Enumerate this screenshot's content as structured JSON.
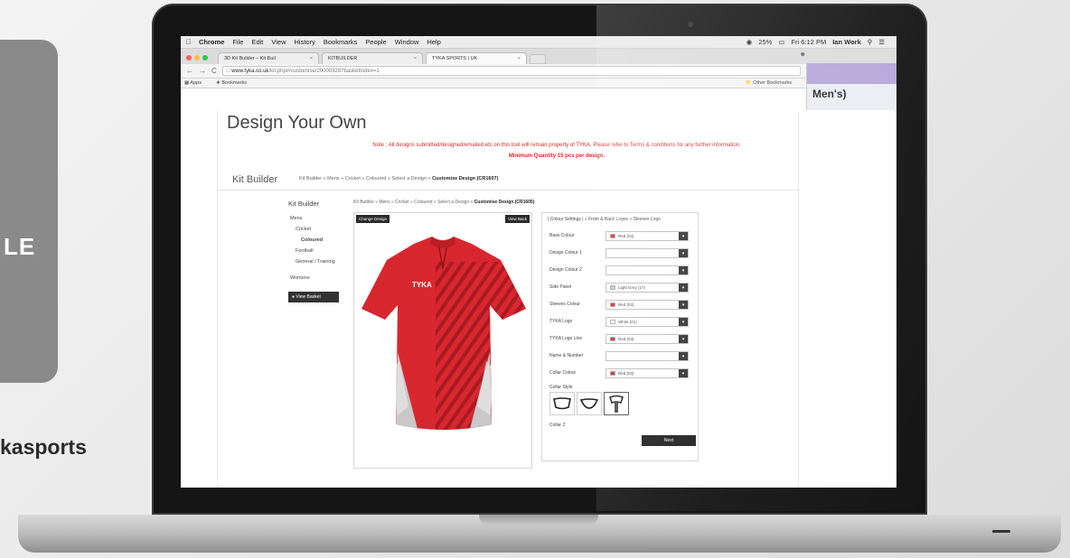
{
  "slide": {
    "card_text": "LE",
    "handle": "kasports"
  },
  "macbar": {
    "items": [
      "Chrome",
      "File",
      "Edit",
      "View",
      "History",
      "Bookmarks",
      "People",
      "Window",
      "Help"
    ],
    "battery": "25%",
    "clock": "Fri 6:12 PM",
    "user": "Ian Work"
  },
  "browser": {
    "tabs": [
      {
        "label": "3D Kit Builder – Kit Buil"
      },
      {
        "label": "KITBUILDER"
      },
      {
        "label": "TYKA SPORTS | UK"
      }
    ],
    "url_host": "www.tyka.co.uk",
    "url_path": "/kit.php#/customise/20000326?basketIndex=1",
    "bookmarks": {
      "apps": "Apps",
      "bookmarks": "Bookmarks",
      "other": "Other Bookmarks"
    }
  },
  "side_panel": {
    "text": "Men's)"
  },
  "page": {
    "title": "Design Your Own",
    "note": "Note : All designs submitted/designed/emailed etc on this tool will remain property of TYKA. Please refer to Terms & conditions for any further information.",
    "min_qty": "Minimum Quantity 15 pcs per design.",
    "kit_builder_label": "Kit Builder",
    "crumb_plain": "Kit Builder » Mens » Cricket » Coloured » Select a Design »",
    "crumb_bold": "Customise Design (CR1607)"
  },
  "left_nav": {
    "title": "Kit Builder",
    "items": [
      "Mens",
      "Cricket",
      "Coloured",
      "Football",
      "General / Training",
      "Womens"
    ],
    "view_basket": "View Basket"
  },
  "builder": {
    "crumb_plain": "Kit Builder » Mens » Cricket » Coloured » Select a Design »",
    "crumb_bold": "Customise Design (CR1605)",
    "change_design": "Change Design",
    "view_back": "View Back",
    "shirt_logo": "TYKA",
    "shirt_color": "#d8272f",
    "panel_color": "#c9c9c9"
  },
  "settings": {
    "tabs": "| Colour Settings | » Front & Back Logos » Sleeves Logo",
    "rows": [
      {
        "label": "Base Colour",
        "value": "Red (03)",
        "swatch": "#d8272f"
      },
      {
        "label": "Design Colour 1",
        "value": "",
        "swatch": ""
      },
      {
        "label": "Design Colour 2",
        "value": "",
        "swatch": ""
      },
      {
        "label": "Side Panel",
        "value": "Light Grey (17)",
        "swatch": "#c9c9c9"
      },
      {
        "label": "Sleeves Colour",
        "value": "Red (03)",
        "swatch": "#d8272f"
      },
      {
        "label": "TYKA Logo",
        "value": "White (01)",
        "swatch": "#ffffff"
      },
      {
        "label": "TYKA Logo Line",
        "value": "Red (03)",
        "swatch": "#d8272f"
      },
      {
        "label": "Name & Number",
        "value": "",
        "swatch": ""
      },
      {
        "label": "Collar Colour",
        "value": "Red (03)",
        "swatch": "#d8272f"
      }
    ],
    "collar_style": "Collar Style",
    "collar2": "Collar 2",
    "next": "Next"
  }
}
